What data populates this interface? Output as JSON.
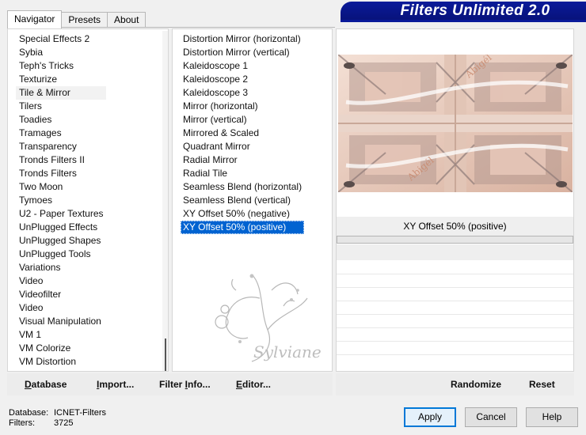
{
  "tabs": [
    "Navigator",
    "Presets",
    "About"
  ],
  "banner_title": "Filters Unlimited 2.0",
  "categories": [
    "Special Effects 2",
    "Sybia",
    "Teph's Tricks",
    "Texturize",
    "Tile & Mirror",
    "Tilers",
    "Toadies",
    "Tramages",
    "Transparency",
    "Tronds Filters II",
    "Tronds Filters",
    "Two Moon",
    "Tymoes",
    "U2 - Paper Textures",
    "UnPlugged Effects",
    "UnPlugged Shapes",
    "UnPlugged Tools",
    "Variations",
    "Video",
    "Videofilter",
    "Video",
    "Visual Manipulation",
    "VM 1",
    "VM Colorize",
    "VM Distortion"
  ],
  "selected_category": "Tile & Mirror",
  "filters": [
    "Distortion Mirror (horizontal)",
    "Distortion Mirror (vertical)",
    "Kaleidoscope 1",
    "Kaleidoscope 2",
    "Kaleidoscope 3",
    "Mirror (horizontal)",
    "Mirror (vertical)",
    "Mirrored & Scaled",
    "Quadrant Mirror",
    "Radial Mirror",
    "Radial Tile",
    "Seamless Blend (horizontal)",
    "Seamless Blend (vertical)",
    "XY Offset 50% (negative)",
    "XY Offset 50% (positive)"
  ],
  "selected_filter": "XY Offset 50% (positive)",
  "watermark_text": "Sylviane",
  "preview_text": "Abigél",
  "preview_label": "XY Offset 50% (positive)",
  "left_buttons": {
    "database": {
      "u": "D",
      "rest": "atabase"
    },
    "import": {
      "u": "I",
      "rest": "mport..."
    },
    "filter_info": {
      "pre": "Filter ",
      "u": "I",
      "rest": "nfo..."
    },
    "editor": {
      "u": "E",
      "rest": "ditor..."
    }
  },
  "right_buttons": {
    "randomize": "Randomize",
    "reset": "Reset"
  },
  "status": {
    "database_label": "Database:",
    "database_value": "ICNET-Filters",
    "filters_label": "Filters:",
    "filters_value": "3725"
  },
  "dialog_buttons": {
    "apply": "Apply",
    "cancel": "Cancel",
    "help": "Help"
  },
  "colors": {
    "banner": "#0a1a9a",
    "selection": "#0063d1",
    "preview_base": "#e9cfc2"
  },
  "icons": {
    "watermark": "floral-swirl-icon"
  }
}
